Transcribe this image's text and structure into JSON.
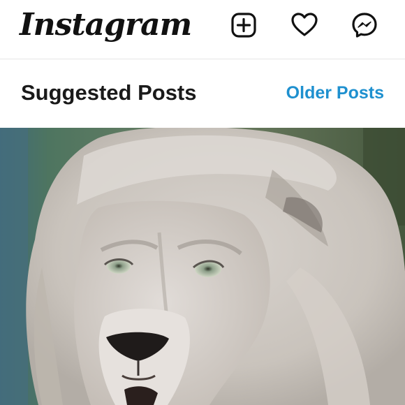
{
  "header": {
    "logo_text": "Instagram",
    "icons": {
      "new_post": "plus-square-icon",
      "activity": "heart-icon",
      "messages": "messenger-icon"
    }
  },
  "section": {
    "title": "Suggested Posts",
    "older_link": "Older Posts"
  },
  "post": {
    "image_subject": "white-lion"
  },
  "colors": {
    "link": "#1e90cf",
    "text": "#1a1a1a",
    "icon": "#111111",
    "divider": "#e6e6e6"
  }
}
